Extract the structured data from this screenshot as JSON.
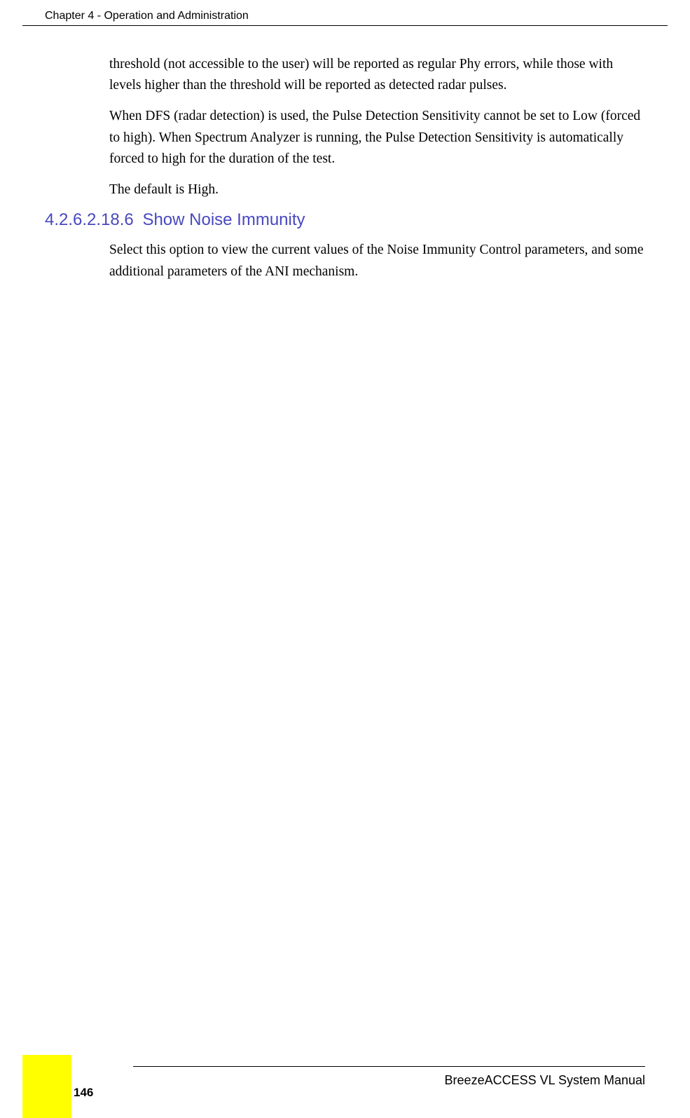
{
  "header": {
    "chapter_title": "Chapter 4 - Operation and Administration"
  },
  "body": {
    "para1": "threshold (not accessible to the user) will be reported as regular Phy errors, while those with levels higher than the threshold will be reported as detected radar pulses.",
    "para2": "When DFS (radar detection) is used, the Pulse Detection Sensitivity cannot be set to Low (forced to high). When Spectrum Analyzer is running, the Pulse Detection Sensitivity is automatically forced to high for the duration of the test.",
    "para3": "The default is High.",
    "section_number": "4.2.6.2.18.6",
    "section_title": "Show Noise Immunity",
    "para4": "Select this option to view the current values of the Noise Immunity Control parameters, and some additional parameters of the ANI mechanism."
  },
  "footer": {
    "manual_name": "BreezeACCESS VL System Manual",
    "page_number": "146"
  }
}
